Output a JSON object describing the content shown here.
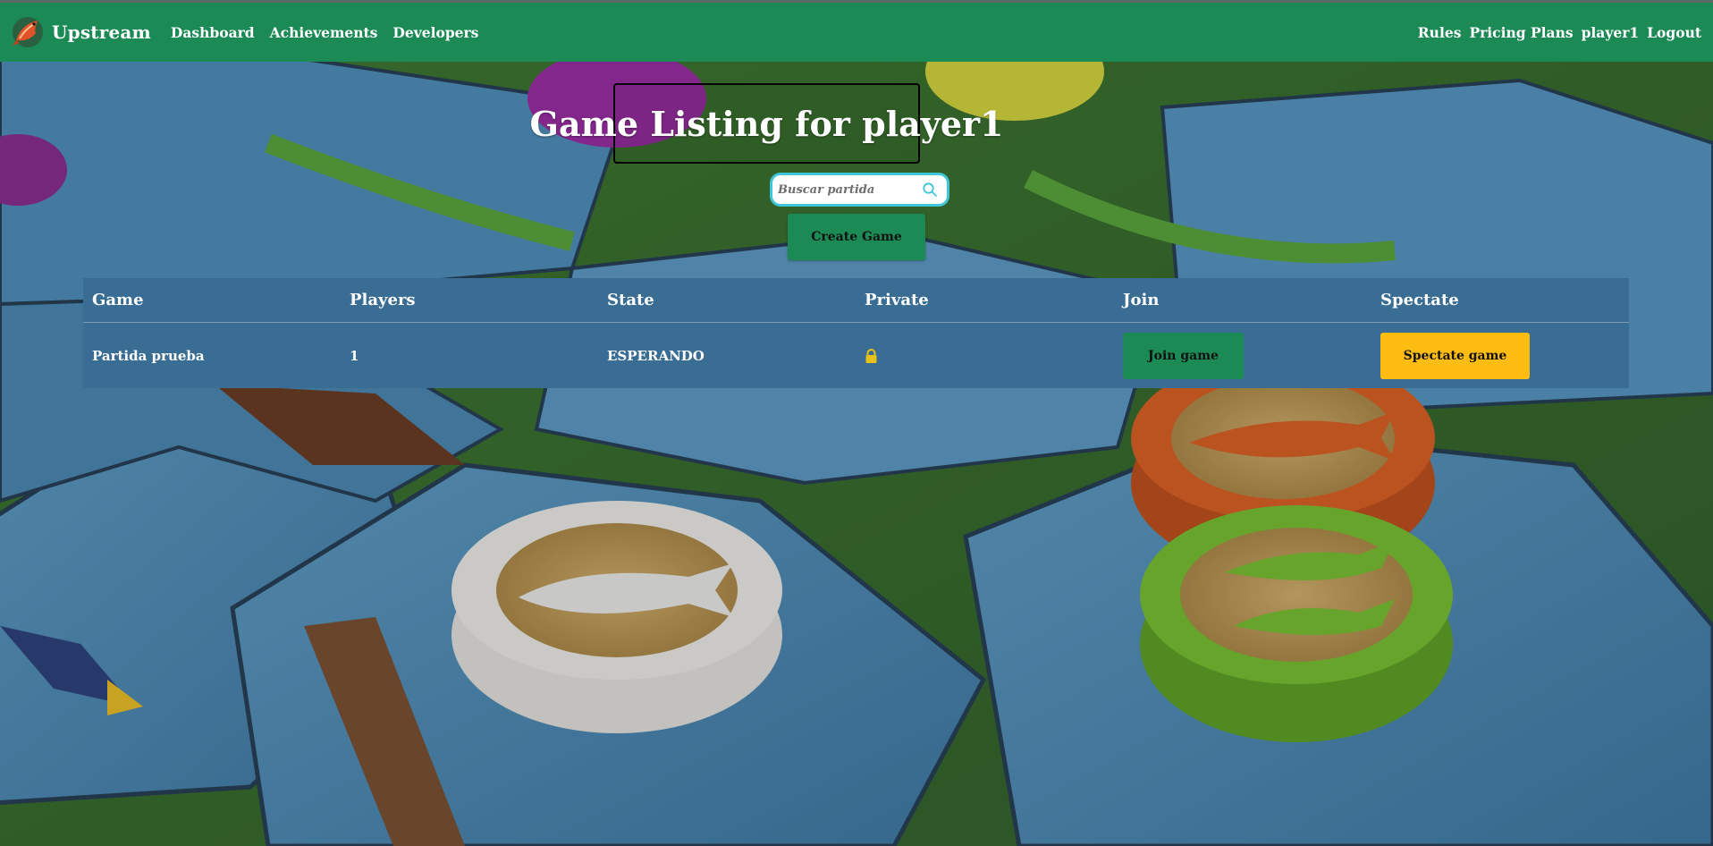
{
  "navbar": {
    "brand": "Upstream",
    "left_links": [
      {
        "label": "Dashboard"
      },
      {
        "label": "Achievements"
      },
      {
        "label": "Developers"
      }
    ],
    "right_links": [
      {
        "label": "Rules"
      },
      {
        "label": "Pricing Plans"
      },
      {
        "label": "player1"
      },
      {
        "label": "Logout"
      }
    ],
    "color": "#1b8a55"
  },
  "page": {
    "title": "Game Listing for player1"
  },
  "search": {
    "placeholder": "Buscar partida",
    "value": "",
    "icon": "search-icon"
  },
  "create_button": {
    "label": "Create Game"
  },
  "table": {
    "headers": [
      "Game",
      "Players",
      "State",
      "Private",
      "Join",
      "Spectate"
    ],
    "rows": [
      {
        "game": "Partida prueba",
        "players": "1",
        "state": "ESPERANDO",
        "private_icon": "lock-icon",
        "join_label": "Join game",
        "spectate_label": "Spectate game"
      }
    ]
  },
  "colors": {
    "primary_green": "#1b8a55",
    "table_blue": "#3a6d94",
    "spectate_yellow": "#fdbc11",
    "search_border": "#3fc7d9",
    "lock_yellow": "#e6c21a"
  }
}
